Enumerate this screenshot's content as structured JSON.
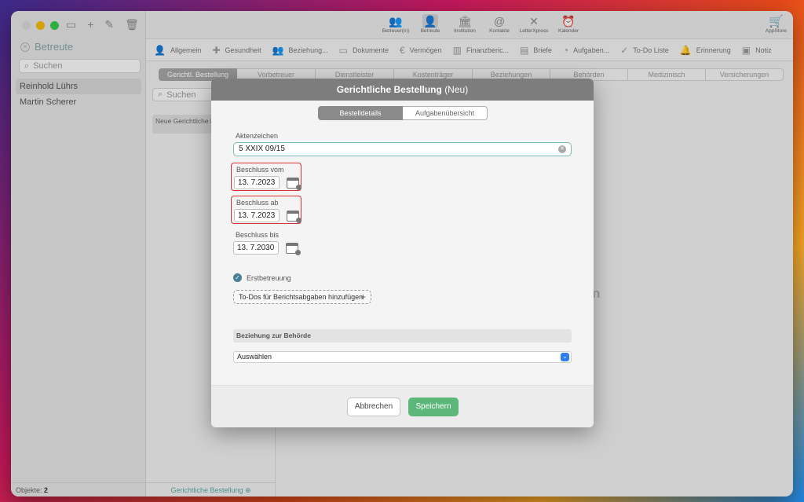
{
  "sidebar": {
    "title": "Betreute",
    "search_placeholder": "Suchen",
    "items": [
      {
        "label": "Reinhold Lührs",
        "selected": true
      },
      {
        "label": "Martin Scherer",
        "selected": false
      }
    ],
    "footer_label": "Objekte:",
    "footer_count": "2"
  },
  "toolbar": {
    "buttons": [
      {
        "label": "Betreuer(in)",
        "icon": "people-icon"
      },
      {
        "label": "Betreute",
        "icon": "person-icon"
      },
      {
        "label": "Institution",
        "icon": "building-icon"
      },
      {
        "label": "Kontakte",
        "icon": "contacts-icon"
      },
      {
        "label": "LetterXpress",
        "icon": "letter-icon"
      },
      {
        "label": "Kalender",
        "icon": "alarm-icon"
      }
    ],
    "appstore_label": "AppStore"
  },
  "categories": [
    {
      "label": "Allgemein",
      "icon": "person-outline-icon"
    },
    {
      "label": "Gesundheit",
      "icon": "medical-icon"
    },
    {
      "label": "Beziehung...",
      "icon": "relations-icon"
    },
    {
      "label": "Dokumente",
      "icon": "folder-icon"
    },
    {
      "label": "Vermögen",
      "icon": "euro-icon"
    },
    {
      "label": "Finanzberic...",
      "icon": "chart-icon"
    },
    {
      "label": "Briefe",
      "icon": "document-icon"
    },
    {
      "label": "Aufgaben...",
      "icon": "tasks-icon"
    },
    {
      "label": "To-Do Liste",
      "icon": "check-circle-icon"
    },
    {
      "label": "Erinnerung",
      "icon": "bell-icon"
    },
    {
      "label": "Notiz",
      "icon": "note-icon"
    }
  ],
  "subtabs": [
    {
      "label": "Gerichtl. Bestellung",
      "active": true
    },
    {
      "label": "Vorbetreuer",
      "active": false
    },
    {
      "label": "Dienstleister",
      "active": false
    },
    {
      "label": "Kostenträger",
      "active": false
    },
    {
      "label": "Beziehungen",
      "active": false
    },
    {
      "label": "Behörden",
      "active": false
    },
    {
      "label": "Medizinisch",
      "active": false
    },
    {
      "label": "Versicherungen",
      "active": false
    }
  ],
  "list_pane": {
    "search_placeholder": "Suchen",
    "item_label": "Neue Gerichtliche B",
    "footer_label": "Gerichtliche Bestellung"
  },
  "background_text": "n",
  "modal": {
    "title": "Gerichtliche Bestellung",
    "title_suffix": "(Neu)",
    "segments": [
      "Bestelldetails",
      "Aufgabenübersicht"
    ],
    "aktenzeichen_label": "Aktenzeichen",
    "aktenzeichen_value": "5 XXIX 09/15",
    "beschluss_vom_label": "Beschluss vom",
    "beschluss_vom_value": "13.  7.2023",
    "beschluss_ab_label": "Beschluss ab",
    "beschluss_ab_value": "13.  7.2023",
    "beschluss_bis_label": "Beschluss bis",
    "beschluss_bis_value": "13.  7.2030",
    "erstbetreuung_label": "Erstbetreuung",
    "erstbetreuung_checked": true,
    "todo_button_label": "To-Dos für Berichtsabgaben hinzufügen",
    "section_header": "Beziehung zur Behörde",
    "select_value": "Auswählen",
    "cancel_label": "Abbrechen",
    "save_label": "Speichern"
  },
  "colors": {
    "accent_green": "#5cb87a",
    "highlight_red": "#d93030",
    "header_gray": "#7d7d7d",
    "select_blue": "#2f80ed"
  }
}
